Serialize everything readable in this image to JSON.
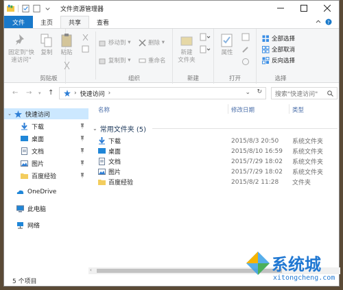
{
  "window": {
    "title": "文件资源管理器"
  },
  "tabs": [
    {
      "label": "文件"
    },
    {
      "label": "主页"
    },
    {
      "label": "共享"
    },
    {
      "label": "查看"
    }
  ],
  "ribbon": {
    "clipboard": {
      "label": "剪贴板",
      "pin_quick": "固定到\"快\n速访问\"",
      "copy": "复制",
      "paste": "粘贴"
    },
    "organize": {
      "label": "组织",
      "move_to": "移动到",
      "copy_to": "复制到",
      "delete": "删除",
      "rename": "重命名"
    },
    "new": {
      "label": "新建",
      "new_folder": "新建\n文件夹"
    },
    "open": {
      "label": "打开",
      "properties": "属性"
    },
    "select": {
      "label": "选择",
      "select_all": "全部选择",
      "select_none": "全部取消",
      "invert": "反向选择"
    }
  },
  "address": {
    "path": "快速访问",
    "search_placeholder": "搜索\"快速访问\""
  },
  "nav": {
    "quick_access": "快速访问",
    "items": [
      {
        "label": "下载"
      },
      {
        "label": "桌面"
      },
      {
        "label": "文档"
      },
      {
        "label": "图片"
      },
      {
        "label": "百度经验"
      }
    ],
    "onedrive": "OneDrive",
    "this_pc": "此电脑",
    "network": "网络"
  },
  "list": {
    "columns": {
      "name": "名称",
      "modified": "修改日期",
      "type": "类型"
    },
    "group": "常用文件夹 (5)",
    "rows": [
      {
        "name": "下载",
        "date": "2015/8/3 20:50",
        "type": "系统文件夹",
        "icon": "download-icon"
      },
      {
        "name": "桌面",
        "date": "2015/8/10 16:59",
        "type": "系统文件夹",
        "icon": "desktop-icon"
      },
      {
        "name": "文档",
        "date": "2015/7/29 18:02",
        "type": "系统文件夹",
        "icon": "document-icon"
      },
      {
        "name": "图片",
        "date": "2015/7/29 18:02",
        "type": "系统文件夹",
        "icon": "picture-icon"
      },
      {
        "name": "百度经验",
        "date": "2015/8/2 11:28",
        "type": "文件夹",
        "icon": "folder-icon"
      }
    ]
  },
  "status": {
    "count": "5 个项目"
  },
  "watermark": {
    "text": "系统城",
    "url": "xitongcheng.com"
  }
}
